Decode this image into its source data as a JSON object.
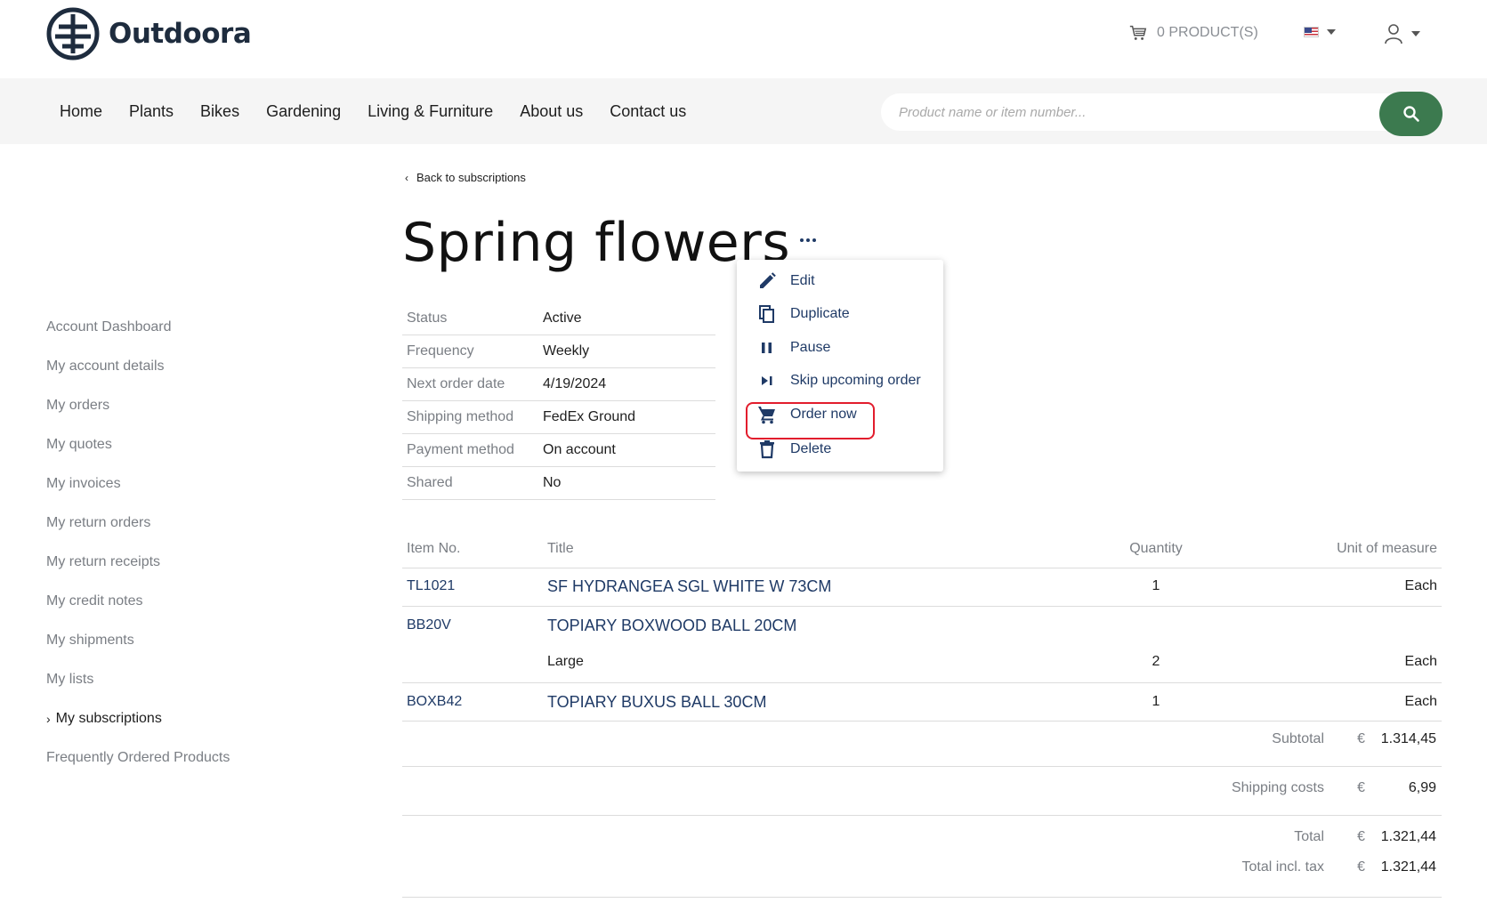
{
  "brand": {
    "name": "Outdoora"
  },
  "header": {
    "cart_label": "0 PRODUCT(S)"
  },
  "nav": {
    "items": [
      "Home",
      "Plants",
      "Bikes",
      "Gardening",
      "Living & Furniture",
      "About us",
      "Contact us"
    ],
    "search_placeholder": "Product name or item number..."
  },
  "sidebar": {
    "items": [
      "Account Dashboard",
      "My account details",
      "My orders",
      "My quotes",
      "My invoices",
      "My return orders",
      "My return receipts",
      "My credit notes",
      "My shipments",
      "My lists",
      "My subscriptions",
      "Frequently Ordered Products"
    ],
    "active_index": 10
  },
  "page": {
    "back_label": "Back to subscriptions",
    "title": "Spring flowers"
  },
  "details": [
    {
      "label": "Status",
      "value": "Active"
    },
    {
      "label": "Frequency",
      "value": "Weekly"
    },
    {
      "label": "Next order date",
      "value": "4/19/2024"
    },
    {
      "label": "Shipping method",
      "value": "FedEx Ground"
    },
    {
      "label": "Payment method",
      "value": "On account"
    },
    {
      "label": "Shared",
      "value": "No"
    }
  ],
  "actions_menu": {
    "items": [
      {
        "label": "Edit",
        "icon": "pencil-icon"
      },
      {
        "label": "Duplicate",
        "icon": "copy-icon"
      },
      {
        "label": "Pause",
        "icon": "pause-icon"
      },
      {
        "label": "Skip upcoming order",
        "icon": "skip-next-icon"
      },
      {
        "label": "Order now",
        "icon": "cart-icon",
        "highlighted": true
      },
      {
        "label": "Delete",
        "icon": "trash-icon"
      }
    ]
  },
  "items_table": {
    "headers": {
      "item_no": "Item No.",
      "title": "Title",
      "quantity": "Quantity",
      "uom": "Unit of measure"
    },
    "rows": [
      {
        "item_no": "TL1021",
        "title": "SF HYDRANGEA SGL WHITE W 73CM",
        "variant": "",
        "quantity": "1",
        "uom": "Each"
      },
      {
        "item_no": "BB20V",
        "title": "TOPIARY BOXWOOD BALL 20CM",
        "variant": "Large",
        "quantity": "2",
        "uom": "Each"
      },
      {
        "item_no": "BOXB42",
        "title": "TOPIARY BUXUS BALL 30CM",
        "variant": "",
        "quantity": "1",
        "uom": "Each"
      }
    ]
  },
  "totals": {
    "currency": "€",
    "subtotal_label": "Subtotal",
    "subtotal": "1.314,45",
    "shipping_label": "Shipping costs",
    "shipping": "6,99",
    "total_label": "Total",
    "total": "1.321,44",
    "total_incl_tax_label": "Total incl. tax",
    "total_incl_tax": "1.321,44"
  },
  "colors": {
    "brand_dark": "#1e2c3e",
    "link_blue": "#1f3a66",
    "search_green": "#3c7a4f",
    "highlight_red": "#e21d2d"
  }
}
